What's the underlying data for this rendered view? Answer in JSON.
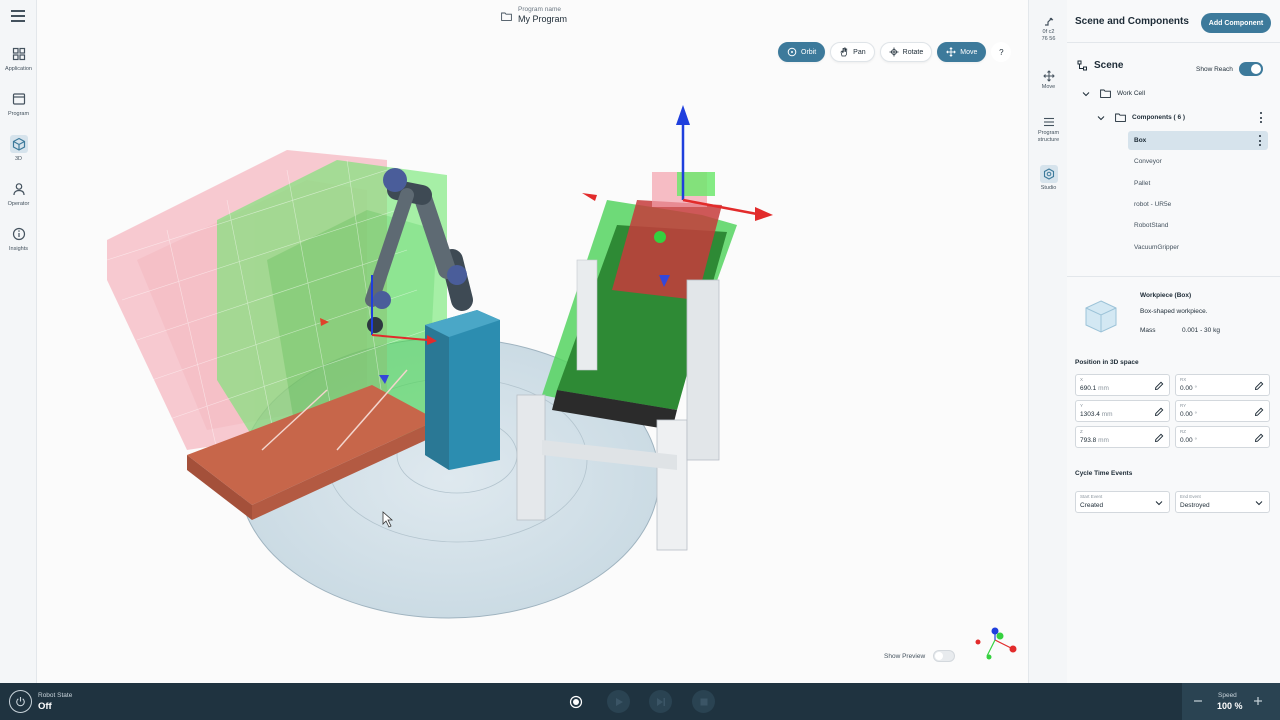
{
  "nav": {
    "items": [
      {
        "label": "Application",
        "icon": "grid-icon"
      },
      {
        "label": "Program",
        "icon": "window-icon"
      },
      {
        "label": "3D",
        "icon": "cube-icon"
      },
      {
        "label": "Operator",
        "icon": "person-icon"
      },
      {
        "label": "Insights",
        "icon": "info-icon"
      }
    ],
    "active": "3D"
  },
  "program": {
    "caption": "Program name",
    "name": "My Program"
  },
  "view_tools": {
    "orbit": "Orbit",
    "pan": "Pan",
    "rotate": "Rotate",
    "move": "Move",
    "help": "?"
  },
  "midbar": {
    "coords_line1": "0f c2",
    "coords_line2": "76 56",
    "move": "Move",
    "program_structure_1": "Program",
    "program_structure_2": "structure",
    "studio": "Studio"
  },
  "viewport": {
    "show_preview": "Show Preview"
  },
  "panel": {
    "title": "Scene and Components",
    "add_button": "Add Component",
    "scene_title": "Scene",
    "show_reach": "Show Reach",
    "work_cell": "Work Cell",
    "components_label": "Components ( 6 )",
    "components": [
      "Box",
      "Conveyor",
      "Pallet",
      "robot - UR5e",
      "RobotStand",
      "VacuumGripper"
    ],
    "selected": "Box",
    "workpiece": {
      "title": "Workpiece (Box)",
      "desc": "Box-shaped workpiece.",
      "mass_label": "Mass",
      "mass_value": "0.001 - 30 kg"
    },
    "position_title": "Position in 3D space",
    "fields": {
      "x": {
        "label": "X",
        "value": "690.1",
        "unit": " mm"
      },
      "rx": {
        "label": "RX",
        "value": "0.00",
        "unit": " °"
      },
      "y": {
        "label": "Y",
        "value": "1303.4",
        "unit": " mm"
      },
      "ry": {
        "label": "RY",
        "value": "0.00",
        "unit": " °"
      },
      "z": {
        "label": "Z",
        "value": "793.8",
        "unit": " mm"
      },
      "rz": {
        "label": "RZ",
        "value": "0.00",
        "unit": " °"
      }
    },
    "cycle_title": "Cycle Time Events",
    "start_event": {
      "label": "Start Event",
      "value": "Created"
    },
    "end_event": {
      "label": "End Event",
      "value": "Destroyed"
    }
  },
  "bottom": {
    "robot_state_label": "Robot State",
    "robot_state_value": "Off",
    "speed_label": "Speed",
    "speed_value": "100 %"
  },
  "colors": {
    "accent": "#3d7a9b",
    "bottom_bar": "#1f3340",
    "reach_green": "#35d13f",
    "reach_red": "#f07a8a"
  }
}
